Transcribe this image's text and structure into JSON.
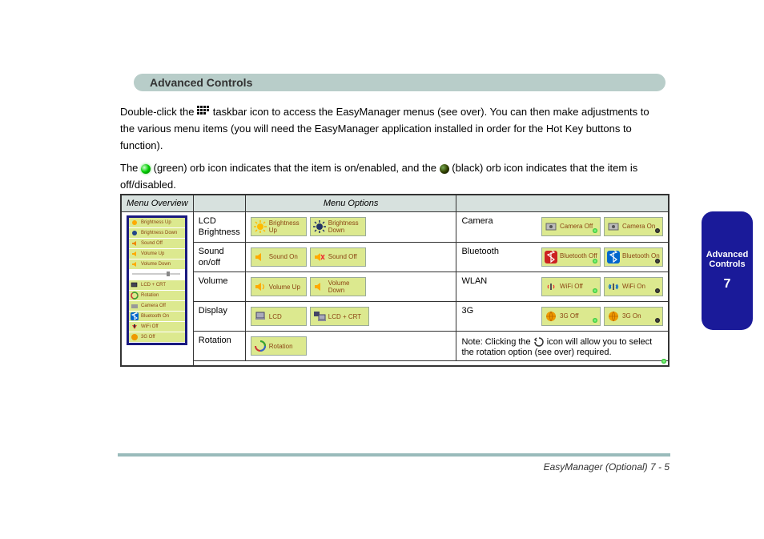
{
  "header": "Advanced Controls",
  "intro": {
    "pre_icon": "Double-click the   ",
    "post_icon": " taskbar icon to access the EasyManager menus (see over). You can then make adjustments to the various menu items (you will need the EasyManager application installed in order for the Hot Key buttons to function).",
    "para2_pre": "The ",
    "para2_mid": " (green) orb icon indicates that the item is on/enabled, and the ",
    "para2_post": " (black) orb icon indicates that the item is off/disabled."
  },
  "table": {
    "headers": [
      "Menu Overview",
      "",
      "Menu Options",
      ""
    ],
    "rows": [
      {
        "left_label": "LCD Brightness",
        "left_pair": [
          "Brightness Up",
          "Brightness Down"
        ],
        "right_label": "Camera",
        "right_pair": [
          "Camera Off",
          "Camera On"
        ]
      },
      {
        "left_label": "Sound on/off",
        "left_pair": [
          "Sound On",
          "Sound Off"
        ],
        "right_label": "Bluetooth",
        "right_pair": [
          "Bluetooth Off",
          "Bluetooth On"
        ]
      },
      {
        "left_label": "Volume",
        "left_pair": [
          "Volume Up",
          "Volume Down"
        ],
        "right_label": "WLAN",
        "right_pair": [
          "WiFi Off",
          "WiFi On"
        ]
      },
      {
        "left_label": "Display",
        "left_pair": [
          "LCD",
          "LCD + CRT"
        ],
        "right_label": "3G",
        "right_pair": [
          "3G Off",
          "3G On"
        ]
      },
      {
        "left_label": "Rotation",
        "left_btn": "Rotation",
        "right_note_pre": "Note: Clicking the ",
        "right_note_post": " icon will allow you to select the rotation option (see over) required."
      }
    ],
    "mini_menu": [
      "Brightness Up",
      "Brightness Down",
      "Sound Off",
      "Volume Up",
      "Volume Down",
      "LCD + CRT",
      "Rotation",
      "Camera Off",
      "Bluetooth On",
      "WiFi Off",
      "3G Off"
    ]
  },
  "side": {
    "line1": "Advanced",
    "line2": "Controls",
    "page": "7"
  },
  "footer": "EasyManager (Optional) 7 - 5"
}
